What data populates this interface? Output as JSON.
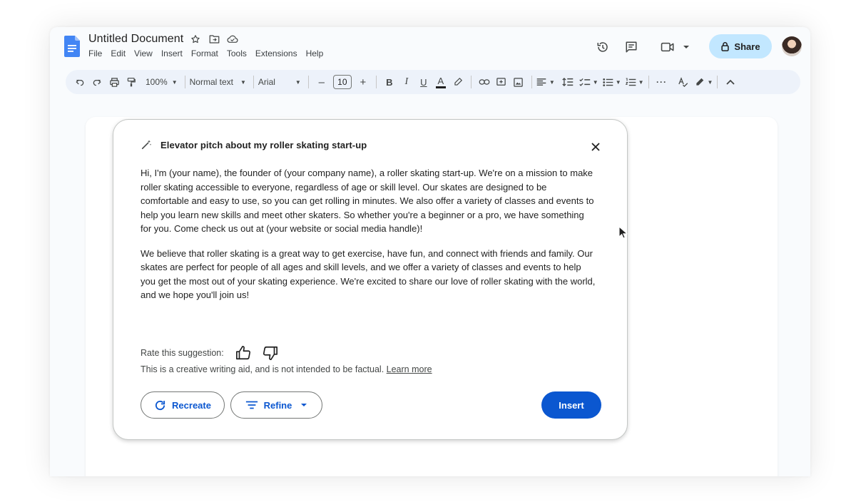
{
  "document": {
    "title": "Untitled Document"
  },
  "menu": [
    "File",
    "Edit",
    "View",
    "Insert",
    "Format",
    "Tools",
    "Extensions",
    "Help"
  ],
  "header": {
    "share_label": "Share",
    "icons": [
      "history-icon",
      "comment-icon",
      "meet-icon",
      "lock-icon",
      "avatar"
    ]
  },
  "toolbar": {
    "zoom": "100%",
    "style": "Normal text",
    "font": "Arial",
    "font_size": "10",
    "minus": "–",
    "plus": "+",
    "bold": "B",
    "italic": "I",
    "underline": "U",
    "text_color": "A",
    "more": "···"
  },
  "card": {
    "title": "Elevator pitch about my roller skating start-up",
    "paragraphs": [
      "Hi, I'm (your name), the founder of (your company name), a roller skating start-up. We're on a mission to make roller skating accessible to everyone, regardless of age or skill level. Our skates are designed to be comfortable and easy to use, so you can get rolling in minutes. We also offer a variety of classes and events to help you learn new skills and meet other skaters. So whether you're a beginner or a pro, we have something for you. Come check us out at (your website or social media handle)!",
      "We believe that roller skating is a great way to get exercise, have fun, and connect with friends and family. Our skates are perfect for people of all ages and skill levels, and we offer a variety of classes and events to help you get the most out of your skating experience. We're excited to share our love of roller skating with the world, and we hope you'll join us!"
    ],
    "rate_label": "Rate this suggestion:",
    "disclaimer": "This is a creative writing aid, and is not intended to be factual.",
    "learn_more": "Learn more",
    "recreate_label": "Recreate",
    "refine_label": "Refine",
    "insert_label": "Insert"
  },
  "colors": {
    "accent": "#0b57d0",
    "share_bg": "#c2e7ff",
    "toolbar_bg": "#edf2fa",
    "docs_blue": "#4285f4"
  }
}
